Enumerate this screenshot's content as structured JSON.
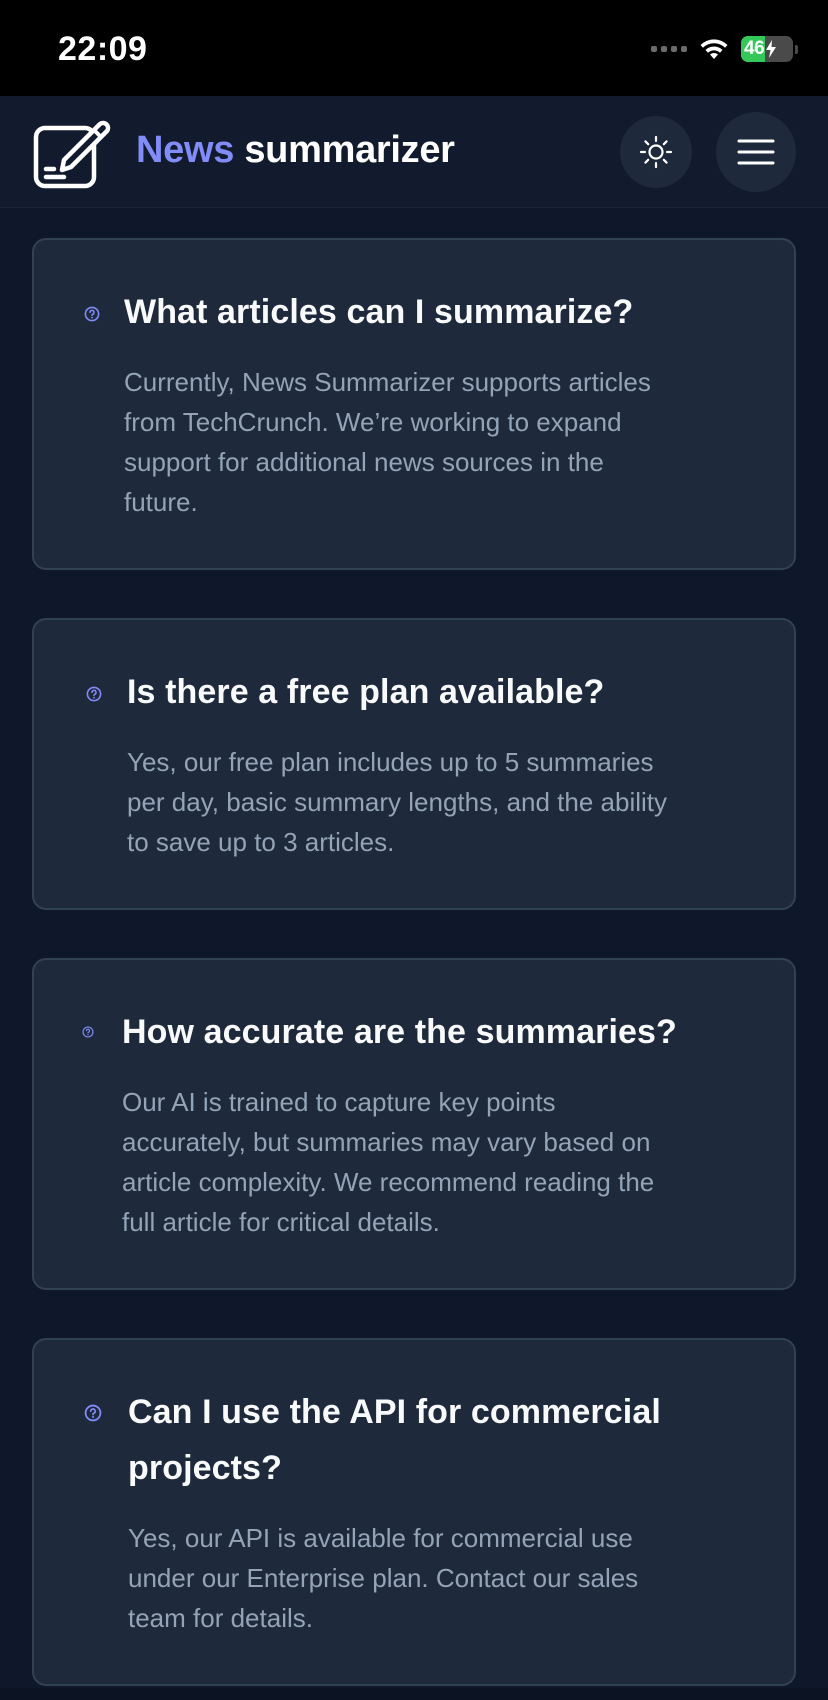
{
  "status_bar": {
    "time": "22:09",
    "battery_percent": "46",
    "battery_level": 0.46,
    "charging": true
  },
  "header": {
    "brand_first": "News",
    "brand_second": "summarizer",
    "logo_icon": "edit-document-icon",
    "theme_toggle_icon": "sun-icon",
    "menu_icon": "hamburger-menu-icon"
  },
  "colors": {
    "background": "#0f172a",
    "card": "#1e293b",
    "card_border": "#334155",
    "accent": "#818cf8",
    "text_primary": "#f8fafc",
    "text_secondary": "#94a3b8"
  },
  "faq": [
    {
      "icon": "question-circle-icon",
      "question": "What articles can I summarize?",
      "answer_lines": [
        "Currently, News Summarizer supports articles",
        "from TechCrunch. We’re working to expand",
        "support for additional news sources in the",
        "future."
      ]
    },
    {
      "icon": "question-circle-icon",
      "question": "Is there a free plan available?",
      "answer_lines": [
        "Yes, our free plan includes up to 5 summaries",
        "per day, basic summary lengths, and the ability",
        "to save up to 3 articles."
      ]
    },
    {
      "icon": "question-circle-icon",
      "question": "How accurate are the summaries?",
      "answer_lines": [
        "Our AI is trained to capture key points",
        "accurately, but summaries may vary based on",
        "article complexity. We recommend reading the",
        "full article for critical details."
      ]
    },
    {
      "icon": "question-circle-icon",
      "question_lines": [
        "Can I use the API for commercial",
        "projects?"
      ],
      "answer_lines": [
        "Yes, our API is available for commercial use",
        "under our Enterprise plan. Contact our sales",
        "team for details."
      ]
    }
  ]
}
